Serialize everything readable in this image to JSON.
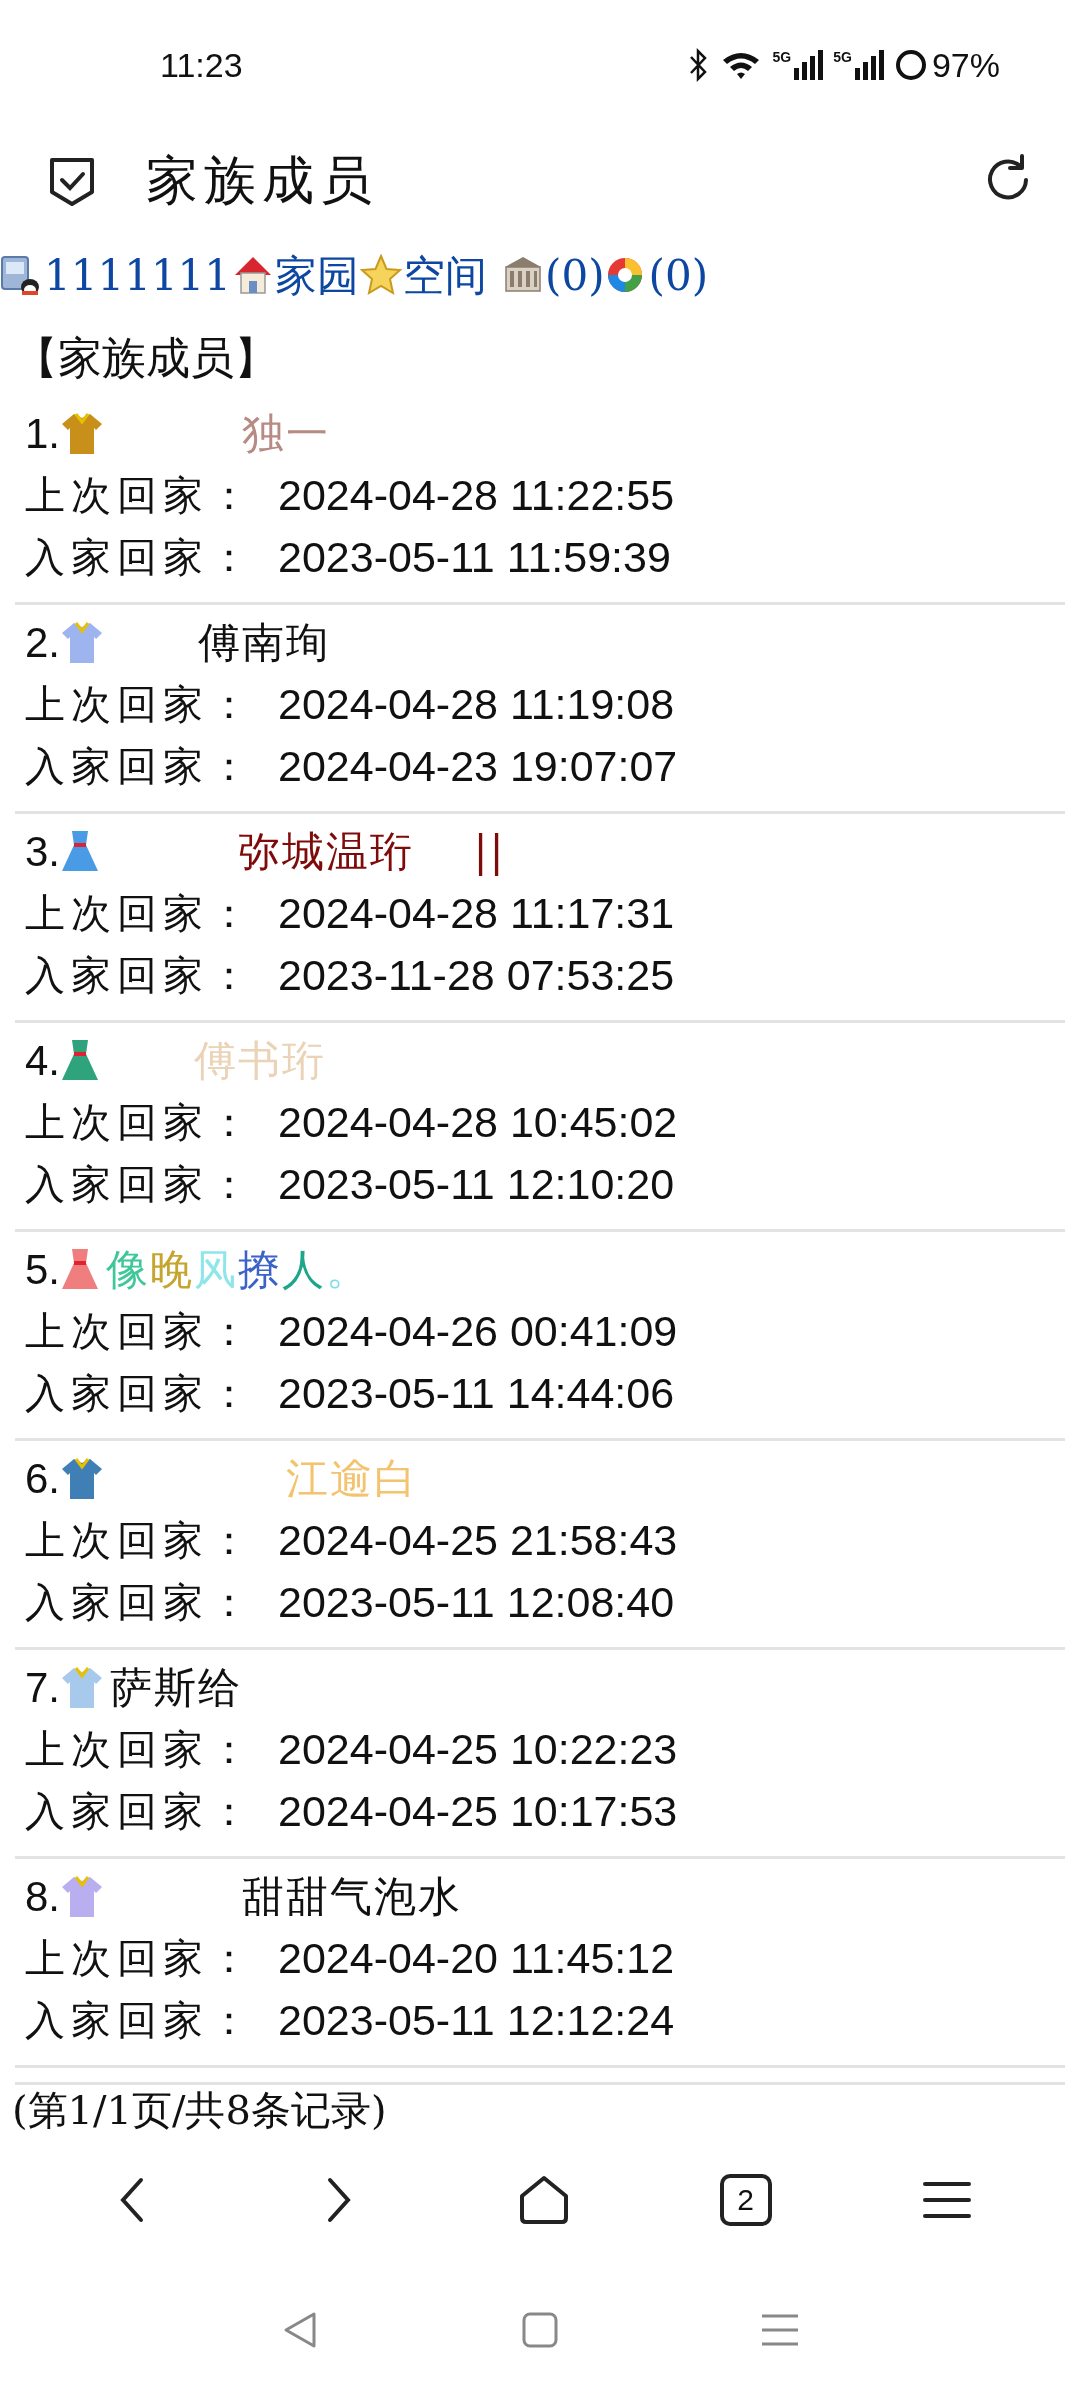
{
  "status_bar": {
    "time": "11:23",
    "networks": [
      "5G",
      "5G"
    ],
    "battery": "97%"
  },
  "title_bar": {
    "title": "家族成员"
  },
  "links": [
    {
      "kind": "account",
      "text": "1111111"
    },
    {
      "kind": "home",
      "text": "家园"
    },
    {
      "kind": "space",
      "text": "空间"
    },
    {
      "kind": "bank",
      "text": "(0)"
    },
    {
      "kind": "album",
      "text": "(0)"
    }
  ],
  "section_heading": "【家族成员】",
  "members": [
    {
      "number": "1.",
      "name": [
        {
          "text": "　　　独一",
          "color": "#b88a84"
        }
      ],
      "last_visit_label": "上次回家：",
      "last_visit": "2024-04-28 11:22:55",
      "join_label": "入家回家：",
      "join": "2023-05-11 11:59:39"
    },
    {
      "number": "2.",
      "name": [
        {
          "text": "　　傅南珣",
          "color": "#111111"
        }
      ],
      "last_visit_label": "上次回家：",
      "last_visit": "2024-04-28 11:19:08",
      "join_label": "入家回家：",
      "join": "2024-04-23 19:07:07"
    },
    {
      "number": "3.",
      "name": [
        {
          "text": "　　　弥城温珩　 ||",
          "color": "#7f0a0a"
        }
      ],
      "last_visit_label": "上次回家：",
      "last_visit": "2024-04-28 11:17:31",
      "join_label": "入家回家：",
      "join": "2023-11-28 07:53:25"
    },
    {
      "number": "4.",
      "name": [
        {
          "text": "　　傅书珩",
          "color": "#ead3b6"
        }
      ],
      "last_visit_label": "上次回家：",
      "last_visit": "2024-04-28 10:45:02",
      "join_label": "入家回家：",
      "join": "2023-05-11 12:10:20"
    },
    {
      "number": "5.",
      "name": [
        {
          "text": "像",
          "color": "#3fc79a"
        },
        {
          "text": "晚",
          "color": "#c6a52e"
        },
        {
          "text": "风",
          "color": "#8fe6ea"
        },
        {
          "text": "撩",
          "color": "#3a62c8"
        },
        {
          "text": "人",
          "color": "#1ea58a"
        },
        {
          "text": "。",
          "color": "#7fdfe6"
        }
      ],
      "last_visit_label": "上次回家：",
      "last_visit": "2024-04-26 00:41:09",
      "join_label": "入家回家：",
      "join": "2023-05-11 14:44:06"
    },
    {
      "number": "6.",
      "name": [
        {
          "text": "　　　　江逾白",
          "color": "#f3c36f"
        }
      ],
      "last_visit_label": "上次回家：",
      "last_visit": "2024-04-25 21:58:43",
      "join_label": "入家回家：",
      "join": "2023-05-11 12:08:40"
    },
    {
      "number": "7.",
      "name": [
        {
          "text": "萨斯给",
          "color": "#111111"
        }
      ],
      "last_visit_label": "上次回家：",
      "last_visit": "2024-04-25 10:22:23",
      "join_label": "入家回家：",
      "join": "2024-04-25 10:17:53"
    },
    {
      "number": "8.",
      "name": [
        {
          "text": "　　　甜甜气泡水",
          "color": "#111111"
        }
      ],
      "last_visit_label": "上次回家：",
      "last_visit": "2024-04-20 11:45:12",
      "join_label": "入家回家：",
      "join": "2023-05-11 12:12:24"
    }
  ],
  "footer": "(第1/1页/共8条记录)",
  "browser_nav": {
    "tab_count": "2"
  }
}
